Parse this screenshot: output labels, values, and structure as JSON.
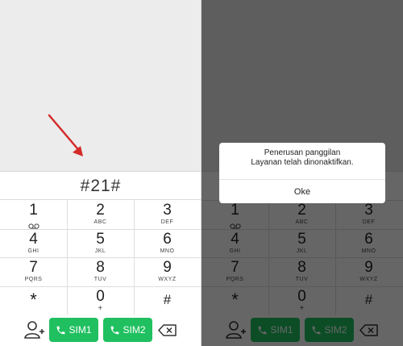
{
  "colors": {
    "sim_green": "#20c060",
    "arrow_red": "#d42a2a",
    "top_gray": "#ececec"
  },
  "dialer": {
    "number": "#21#",
    "keys": [
      {
        "digit": "1",
        "sub": "voicemail-icon"
      },
      {
        "digit": "2",
        "sub": "ABC"
      },
      {
        "digit": "3",
        "sub": "DEF"
      },
      {
        "digit": "4",
        "sub": "GHI"
      },
      {
        "digit": "5",
        "sub": "JKL"
      },
      {
        "digit": "6",
        "sub": "MNO"
      },
      {
        "digit": "7",
        "sub": "PQRS"
      },
      {
        "digit": "8",
        "sub": "TUV"
      },
      {
        "digit": "9",
        "sub": "WXYZ"
      },
      {
        "digit": "*",
        "sub": ""
      },
      {
        "digit": "0",
        "sub": "+"
      },
      {
        "digit": "#",
        "sub": ""
      }
    ],
    "sim1_label": "SIM1",
    "sim2_label": "SIM2"
  },
  "dialog": {
    "title": "Penerusan panggilan",
    "message": "Layanan telah dinonaktifkan.",
    "ok_label": "Oke"
  }
}
